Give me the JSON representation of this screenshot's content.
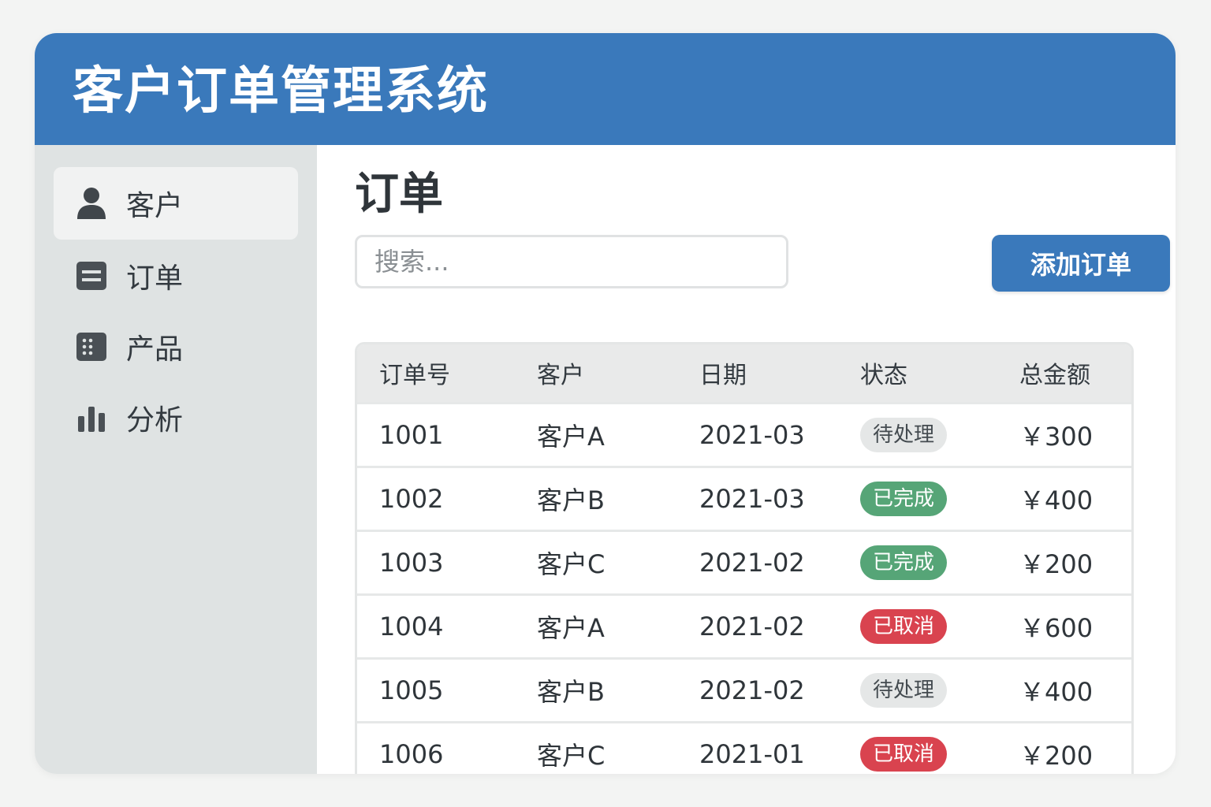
{
  "app": {
    "title": "客户订单管理系统"
  },
  "sidebar": {
    "items": [
      {
        "label": "客户",
        "icon": "user-icon",
        "active": true
      },
      {
        "label": "订单",
        "icon": "order-list-icon",
        "active": false
      },
      {
        "label": "产品",
        "icon": "product-grid-icon",
        "active": false
      },
      {
        "label": "分析",
        "icon": "bar-chart-icon",
        "active": false
      }
    ]
  },
  "main": {
    "title": "订单",
    "search": {
      "placeholder": "搜索...",
      "value": ""
    },
    "add_button_label": "添加订单",
    "table": {
      "headers": [
        "订单号",
        "客户",
        "日期",
        "状态",
        "总金额"
      ],
      "rows": [
        {
          "id": "1001",
          "customer": "客户A",
          "date": "2021-03",
          "status": "待处理",
          "status_type": "pending",
          "amount": "￥300"
        },
        {
          "id": "1002",
          "customer": "客户B",
          "date": "2021-03",
          "status": "已完成",
          "status_type": "done",
          "amount": "￥400"
        },
        {
          "id": "1003",
          "customer": "客户C",
          "date": "2021-02",
          "status": "已完成",
          "status_type": "done",
          "amount": "￥200"
        },
        {
          "id": "1004",
          "customer": "客户A",
          "date": "2021-02",
          "status": "已取消",
          "status_type": "cancel",
          "amount": "￥600"
        },
        {
          "id": "1005",
          "customer": "客户B",
          "date": "2021-02",
          "status": "待处理",
          "status_type": "pending",
          "amount": "￥400"
        },
        {
          "id": "1006",
          "customer": "客户C",
          "date": "2021-01",
          "status": "已取消",
          "status_type": "cancel",
          "amount": "￥200"
        }
      ]
    }
  },
  "colors": {
    "brand": "#3a79bb",
    "sidebar_bg": "#dfe3e3",
    "status_pending": "#e5e7e7",
    "status_done": "#56a577",
    "status_cancel": "#d9434f"
  }
}
